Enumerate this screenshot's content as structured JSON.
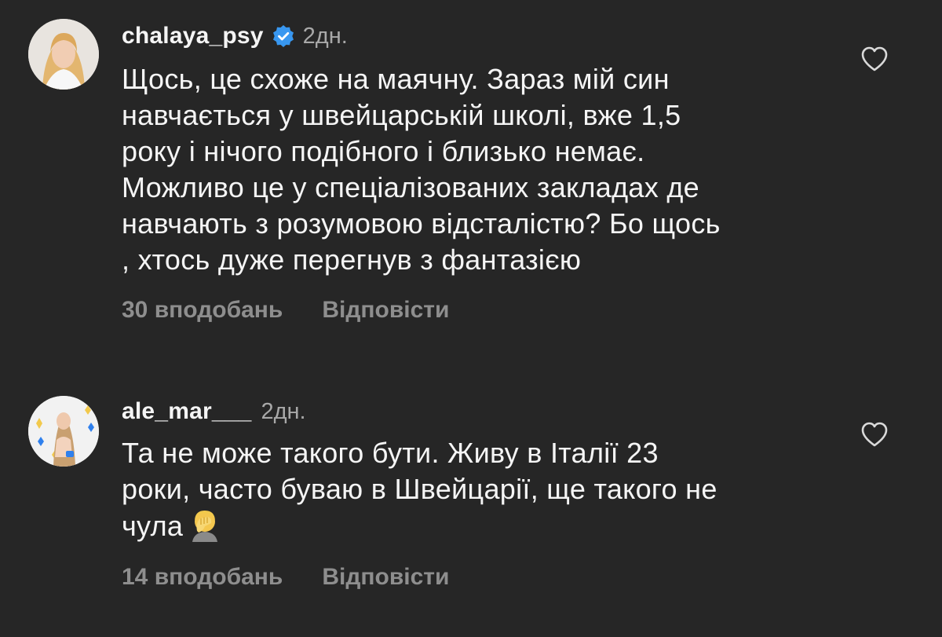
{
  "comments": [
    {
      "username": "chalaya_psy",
      "verified": true,
      "time": "2дн.",
      "lines": [
        "Щось, це схоже на маячну. Зараз мій син",
        "навчається у швейцарській школі, вже 1,5",
        "року і нічого подібного і близько немає.",
        "Можливо це у спеціалізованих закладах де",
        "навчають з розумовою відсталістю? Бо щось",
        ", хтось дуже перегнув з фантазією"
      ],
      "likes": "30 вподобань",
      "reply": "Відповісти"
    },
    {
      "username": "ale_mar___",
      "verified": false,
      "time": "2дн.",
      "lines": [
        "Та не може такого бути. Живу в Італії 23",
        "роки, часто буваю в Швейцарії, ще такого не",
        "чула"
      ],
      "emoji": "face-palm-emoji",
      "likes": "14 вподобань",
      "reply": "Відповісти"
    }
  ],
  "icons": {
    "verified_badge": "verified-badge-icon",
    "like": "heart-outline-icon"
  },
  "colors": {
    "background": "#262626",
    "text_primary": "#f5f5f5",
    "text_secondary": "#a8a8a8",
    "actions": "#8e8e8e",
    "verified": "#3897f0"
  }
}
